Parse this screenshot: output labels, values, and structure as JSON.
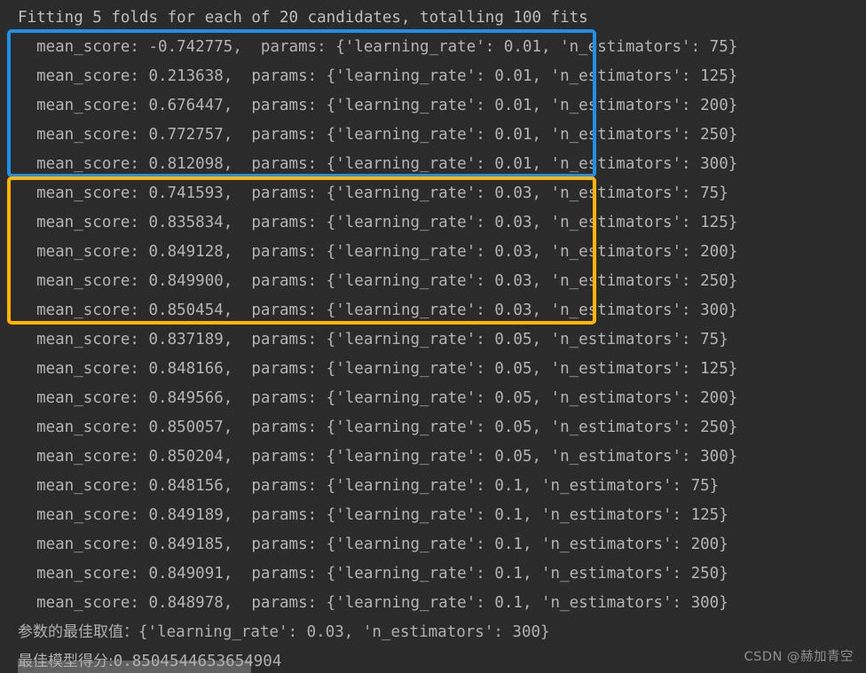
{
  "terminal": {
    "background_color": "#2b2b2b",
    "text_color": "#b4b4b4",
    "header_line": "Fitting 5 folds for each of 20 candidates, totalling 100 fits",
    "lines": [
      "  mean_score: -0.742775,  params: {'learning_rate': 0.01, 'n_estimators': 75}",
      "  mean_score: 0.213638,  params: {'learning_rate': 0.01, 'n_estimators': 125}",
      "  mean_score: 0.676447,  params: {'learning_rate': 0.01, 'n_estimators': 200}",
      "  mean_score: 0.772757,  params: {'learning_rate': 0.01, 'n_estimators': 250}",
      "  mean_score: 0.812098,  params: {'learning_rate': 0.01, 'n_estimators': 300}",
      "  mean_score: 0.741593,  params: {'learning_rate': 0.03, 'n_estimators': 75}",
      "  mean_score: 0.835834,  params: {'learning_rate': 0.03, 'n_estimators': 125}",
      "  mean_score: 0.849128,  params: {'learning_rate': 0.03, 'n_estimators': 200}",
      "  mean_score: 0.849900,  params: {'learning_rate': 0.03, 'n_estimators': 250}",
      "  mean_score: 0.850454,  params: {'learning_rate': 0.03, 'n_estimators': 300}",
      "  mean_score: 0.837189,  params: {'learning_rate': 0.05, 'n_estimators': 75}",
      "  mean_score: 0.848166,  params: {'learning_rate': 0.05, 'n_estimators': 125}",
      "  mean_score: 0.849566,  params: {'learning_rate': 0.05, 'n_estimators': 200}",
      "  mean_score: 0.850057,  params: {'learning_rate': 0.05, 'n_estimators': 250}",
      "  mean_score: 0.850204,  params: {'learning_rate': 0.05, 'n_estimators': 300}",
      "  mean_score: 0.848156,  params: {'learning_rate': 0.1, 'n_estimators': 75}",
      "  mean_score: 0.849189,  params: {'learning_rate': 0.1, 'n_estimators': 125}",
      "  mean_score: 0.849185,  params: {'learning_rate': 0.1, 'n_estimators': 200}",
      "  mean_score: 0.849091,  params: {'learning_rate': 0.1, 'n_estimators': 250}",
      "  mean_score: 0.848978,  params: {'learning_rate': 0.1, 'n_estimators': 300}"
    ],
    "best_params_label": "参数的最佳取值：",
    "best_params_value": "{'learning_rate': 0.03, 'n_estimators': 300}",
    "best_score_label": "最佳模型得分:",
    "best_score_value": "0.8504544653654904"
  },
  "annotations": {
    "blue_box": {
      "name": "learning-rate-0.01-group",
      "color": "#1e90e8",
      "covers_rows": "mean_score rows 1-5 (learning_rate 0.01)"
    },
    "orange_box": {
      "name": "learning-rate-0.03-group",
      "color": "#ffb400",
      "covers_rows": "mean_score rows 6-10 (learning_rate 0.03)"
    }
  },
  "watermark": {
    "text": "CSDN @赫加青空",
    "color": "#8e8e8e"
  },
  "chart_data": {
    "type": "table",
    "title": "Grid search CV results: mean_score by learning_rate and n_estimators",
    "columns": [
      "learning_rate",
      "n_estimators",
      "mean_score"
    ],
    "rows": [
      [
        0.01,
        75,
        -0.742775
      ],
      [
        0.01,
        125,
        0.213638
      ],
      [
        0.01,
        200,
        0.676447
      ],
      [
        0.01,
        250,
        0.772757
      ],
      [
        0.01,
        300,
        0.812098
      ],
      [
        0.03,
        75,
        0.741593
      ],
      [
        0.03,
        125,
        0.835834
      ],
      [
        0.03,
        200,
        0.849128
      ],
      [
        0.03,
        250,
        0.8499
      ],
      [
        0.03,
        300,
        0.850454
      ],
      [
        0.05,
        75,
        0.837189
      ],
      [
        0.05,
        125,
        0.848166
      ],
      [
        0.05,
        200,
        0.849566
      ],
      [
        0.05,
        250,
        0.850057
      ],
      [
        0.05,
        300,
        0.850204
      ],
      [
        0.1,
        75,
        0.848156
      ],
      [
        0.1,
        125,
        0.849189
      ],
      [
        0.1,
        200,
        0.849185
      ],
      [
        0.1,
        250,
        0.849091
      ],
      [
        0.1,
        300,
        0.848978
      ]
    ],
    "folds": 5,
    "candidates": 20,
    "total_fits": 100,
    "best_params": {
      "learning_rate": 0.03,
      "n_estimators": 300
    },
    "best_score": 0.8504544653654904
  }
}
